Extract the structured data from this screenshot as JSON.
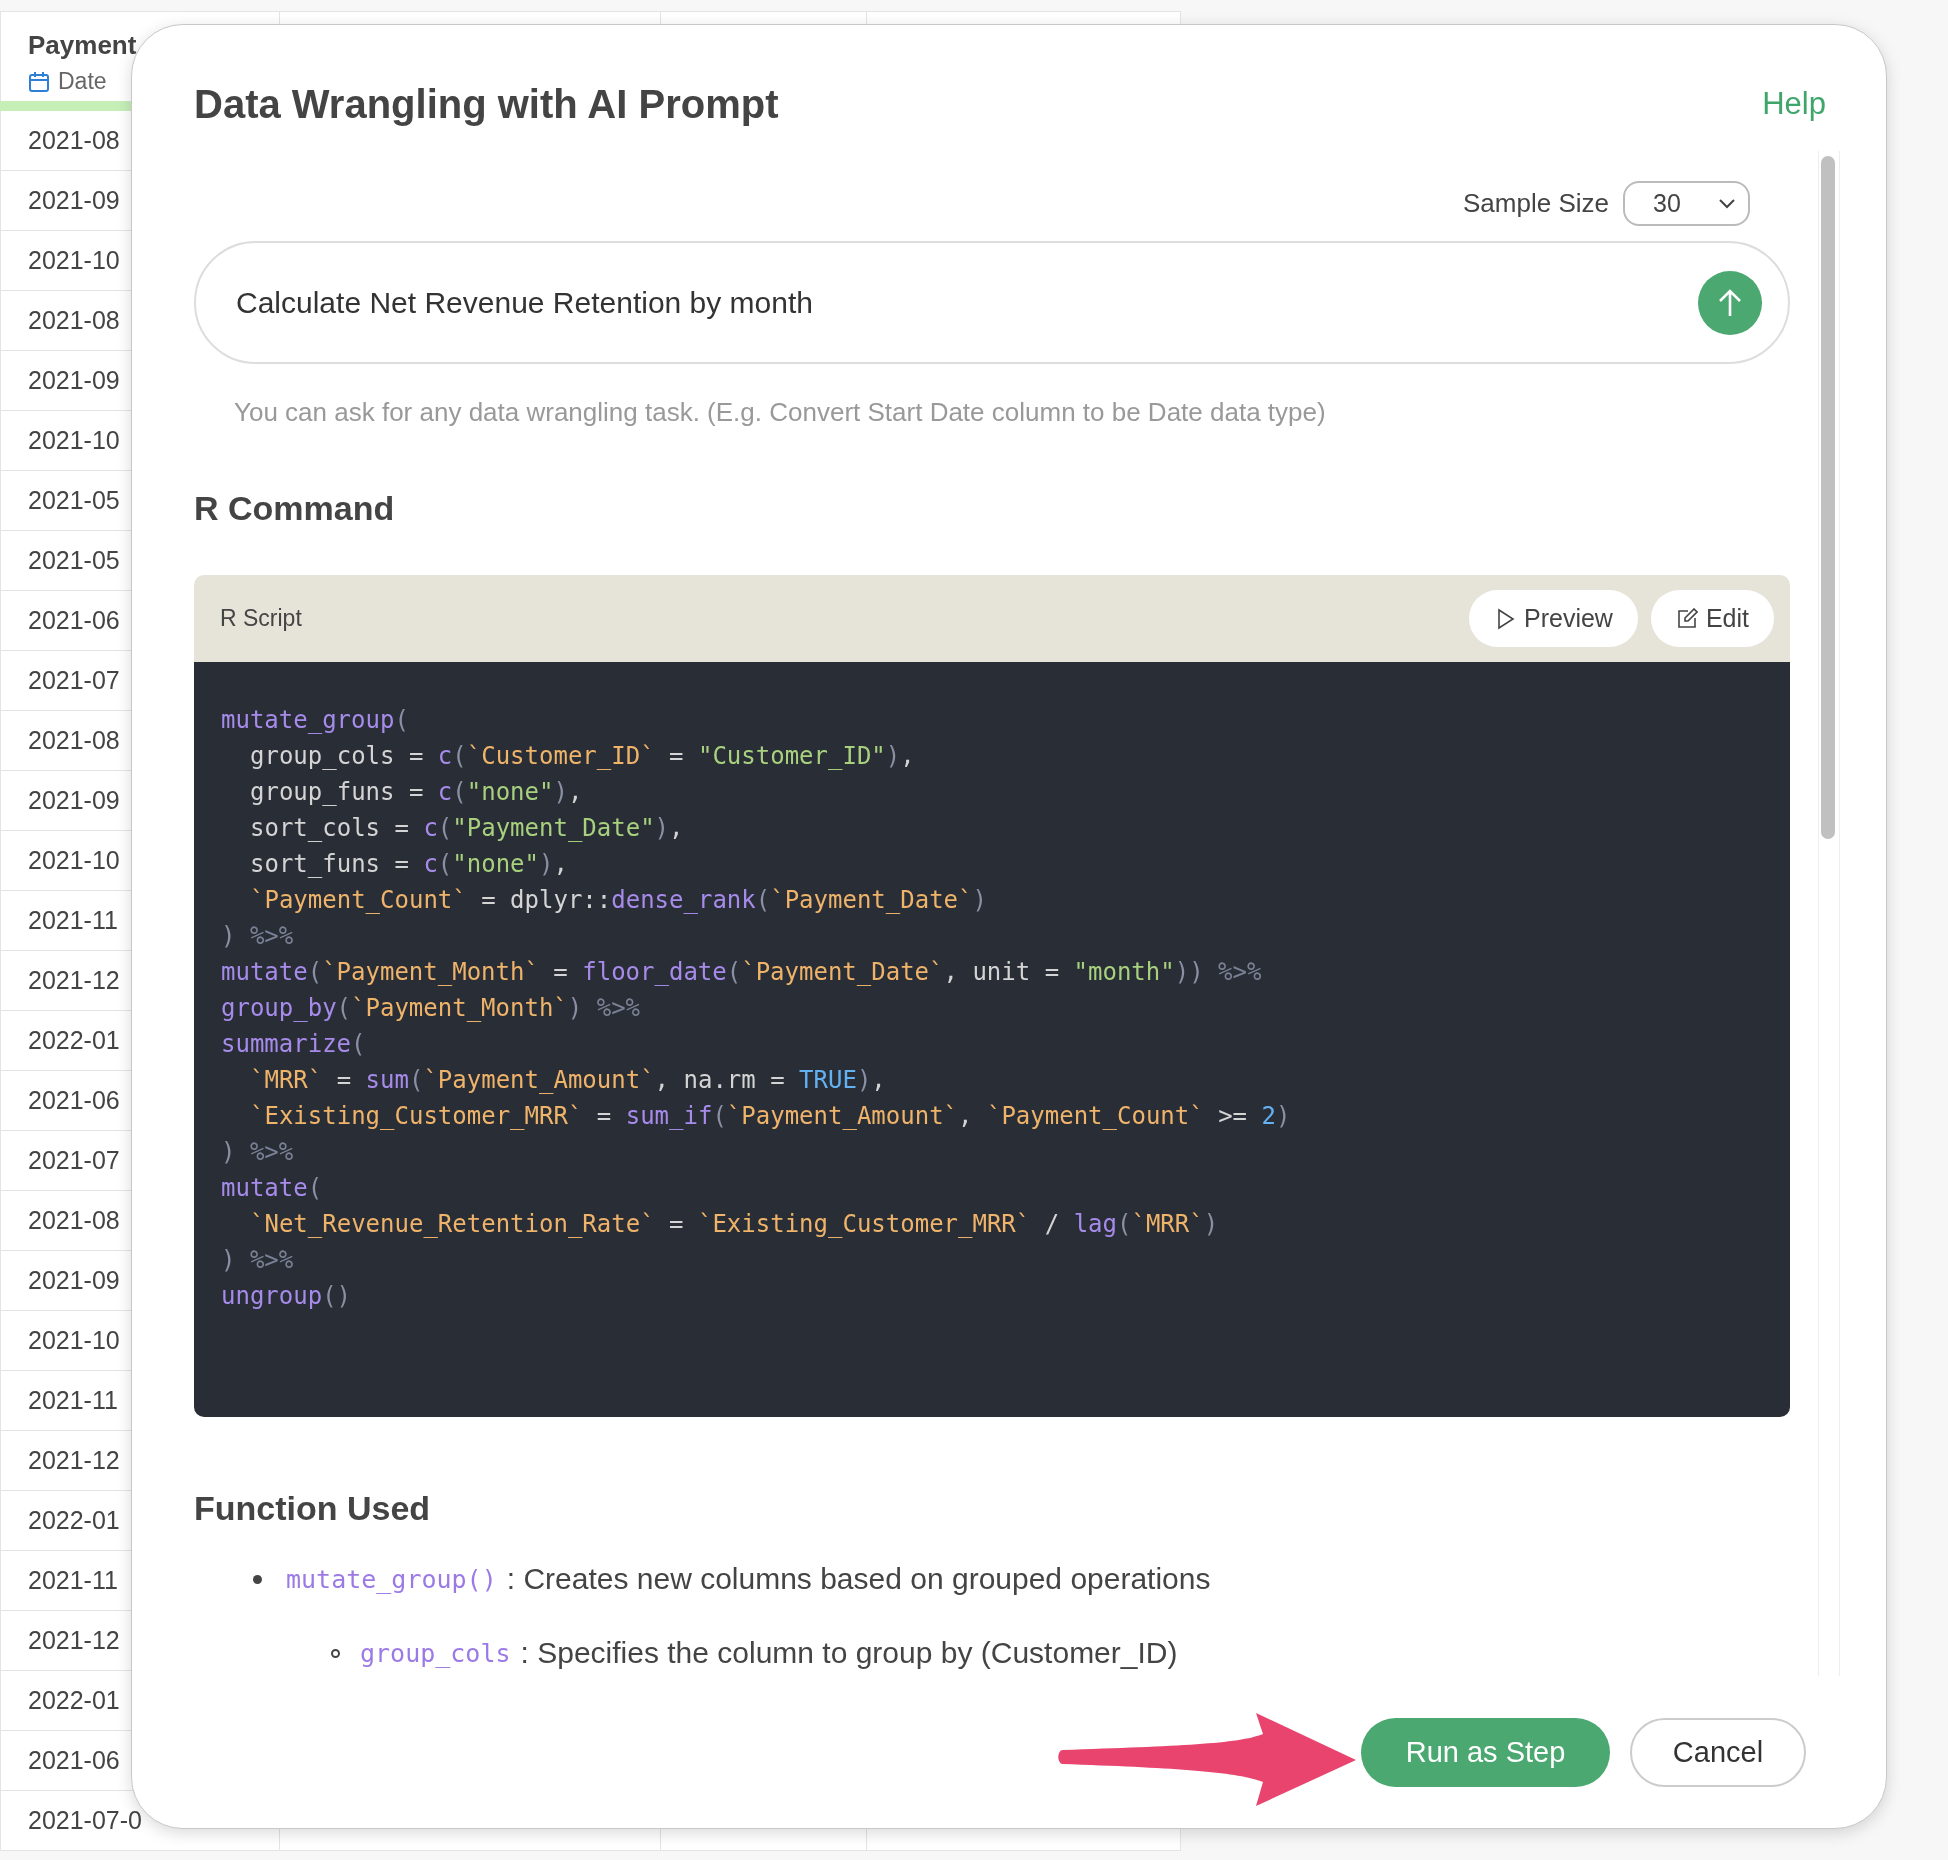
{
  "background_table": {
    "header": {
      "title": "Payment",
      "type": "Date"
    },
    "rows": [
      "2021-08",
      "2021-09",
      "2021-10",
      "2021-08",
      "2021-09",
      "2021-10",
      "2021-05",
      "2021-05",
      "2021-06",
      "2021-07",
      "2021-08",
      "2021-09",
      "2021-10",
      "2021-11",
      "2021-12",
      "2022-01",
      "2021-06",
      "2021-07",
      "2021-08",
      "2021-09",
      "2021-10",
      "2021-11",
      "2021-12",
      "2022-01",
      "2021-11",
      "2021-12",
      "2022-01",
      "2021-06",
      "2021-07-0"
    ]
  },
  "dialog": {
    "title": "Data Wrangling with AI Prompt",
    "help": "Help",
    "sample_size": {
      "label": "Sample Size",
      "value": "30"
    },
    "prompt": {
      "value": "Calculate Net Revenue Retention by month"
    },
    "hint": "You can ask for any data wrangling task. (E.g. Convert Start Date column to be Date data type)",
    "command_title": "R Command",
    "script": {
      "label": "R Script",
      "buttons": [
        "Preview",
        "Edit"
      ],
      "lines": [
        {
          "tokens": [
            {
              "kind": "fn",
              "t": "mutate_group"
            },
            {
              "kind": "punc",
              "t": "("
            }
          ],
          "children": [
            {
              "tokens": [
                {
                  "kind": "plain",
                  "t": "group_cols = "
                },
                {
                  "kind": "fn",
                  "t": "c"
                },
                {
                  "kind": "punc",
                  "t": "("
                },
                {
                  "kind": "col",
                  "t": "`Customer_ID`"
                },
                {
                  "kind": "plain",
                  "t": " = "
                },
                {
                  "kind": "str",
                  "t": "\"Customer_ID\""
                },
                {
                  "kind": "punc",
                  "t": ")"
                },
                {
                  "kind": "plain",
                  "t": ","
                }
              ]
            },
            {
              "tokens": [
                {
                  "kind": "plain",
                  "t": "group_funs = "
                },
                {
                  "kind": "fn",
                  "t": "c"
                },
                {
                  "kind": "punc",
                  "t": "("
                },
                {
                  "kind": "str",
                  "t": "\"none\""
                },
                {
                  "kind": "punc",
                  "t": ")"
                },
                {
                  "kind": "plain",
                  "t": ","
                }
              ]
            },
            {
              "tokens": [
                {
                  "kind": "plain",
                  "t": "sort_cols = "
                },
                {
                  "kind": "fn",
                  "t": "c"
                },
                {
                  "kind": "punc",
                  "t": "("
                },
                {
                  "kind": "str",
                  "t": "\"Payment_Date\""
                },
                {
                  "kind": "punc",
                  "t": ")"
                },
                {
                  "kind": "plain",
                  "t": ","
                }
              ]
            },
            {
              "tokens": [
                {
                  "kind": "plain",
                  "t": "sort_funs = "
                },
                {
                  "kind": "fn",
                  "t": "c"
                },
                {
                  "kind": "punc",
                  "t": "("
                },
                {
                  "kind": "str",
                  "t": "\"none\""
                },
                {
                  "kind": "punc",
                  "t": ")"
                },
                {
                  "kind": "plain",
                  "t": ","
                }
              ]
            },
            {
              "tokens": [
                {
                  "kind": "col",
                  "t": "`Payment_Count`"
                },
                {
                  "kind": "plain",
                  "t": " = dplyr::"
                },
                {
                  "kind": "fn",
                  "t": "dense_rank"
                },
                {
                  "kind": "punc",
                  "t": "("
                },
                {
                  "kind": "col",
                  "t": "`Payment_Date`"
                },
                {
                  "kind": "punc",
                  "t": ")"
                }
              ]
            }
          ]
        },
        {
          "tokens": [
            {
              "kind": "punc",
              "t": ")"
            },
            {
              "kind": "pipe",
              "t": " %>%"
            }
          ]
        },
        {
          "tokens": [
            {
              "kind": "fn",
              "t": "mutate"
            },
            {
              "kind": "punc",
              "t": "("
            },
            {
              "kind": "col",
              "t": "`Payment_Month`"
            },
            {
              "kind": "plain",
              "t": " = "
            },
            {
              "kind": "fn",
              "t": "floor_date"
            },
            {
              "kind": "punc",
              "t": "("
            },
            {
              "kind": "col",
              "t": "`Payment_Date`"
            },
            {
              "kind": "plain",
              "t": ", unit = "
            },
            {
              "kind": "str",
              "t": "\"month\""
            },
            {
              "kind": "punc",
              "t": "))"
            },
            {
              "kind": "pipe",
              "t": " %>%"
            }
          ]
        },
        {
          "tokens": [
            {
              "kind": "fn",
              "t": "group_by"
            },
            {
              "kind": "punc",
              "t": "("
            },
            {
              "kind": "col",
              "t": "`Payment_Month`"
            },
            {
              "kind": "punc",
              "t": ")"
            },
            {
              "kind": "pipe",
              "t": " %>%"
            }
          ]
        },
        {
          "tokens": [
            {
              "kind": "fn",
              "t": "summarize"
            },
            {
              "kind": "punc",
              "t": "("
            }
          ],
          "children": [
            {
              "tokens": [
                {
                  "kind": "col",
                  "t": "`MRR`"
                },
                {
                  "kind": "plain",
                  "t": " = "
                },
                {
                  "kind": "fn",
                  "t": "sum"
                },
                {
                  "kind": "punc",
                  "t": "("
                },
                {
                  "kind": "col",
                  "t": "`Payment_Amount`"
                },
                {
                  "kind": "plain",
                  "t": ", na.rm = "
                },
                {
                  "kind": "lit",
                  "t": "TRUE"
                },
                {
                  "kind": "punc",
                  "t": ")"
                },
                {
                  "kind": "plain",
                  "t": ","
                }
              ]
            },
            {
              "tokens": [
                {
                  "kind": "col",
                  "t": "`Existing_Customer_MRR`"
                },
                {
                  "kind": "plain",
                  "t": " = "
                },
                {
                  "kind": "fn",
                  "t": "sum_if"
                },
                {
                  "kind": "punc",
                  "t": "("
                },
                {
                  "kind": "col",
                  "t": "`Payment_Amount`"
                },
                {
                  "kind": "plain",
                  "t": ", "
                },
                {
                  "kind": "col",
                  "t": "`Payment_Count`"
                },
                {
                  "kind": "plain",
                  "t": " >= "
                },
                {
                  "kind": "lit",
                  "t": "2"
                },
                {
                  "kind": "punc",
                  "t": ")"
                }
              ]
            }
          ]
        },
        {
          "tokens": [
            {
              "kind": "punc",
              "t": ")"
            },
            {
              "kind": "pipe",
              "t": " %>%"
            }
          ]
        },
        {
          "tokens": [
            {
              "kind": "fn",
              "t": "mutate"
            },
            {
              "kind": "punc",
              "t": "("
            }
          ],
          "children": [
            {
              "tokens": [
                {
                  "kind": "col",
                  "t": "`Net_Revenue_Retention_Rate`"
                },
                {
                  "kind": "plain",
                  "t": " = "
                },
                {
                  "kind": "col",
                  "t": "`Existing_Customer_MRR`"
                },
                {
                  "kind": "plain",
                  "t": " / "
                },
                {
                  "kind": "fn",
                  "t": "lag"
                },
                {
                  "kind": "punc",
                  "t": "("
                },
                {
                  "kind": "col",
                  "t": "`MRR`"
                },
                {
                  "kind": "punc",
                  "t": ")"
                }
              ]
            }
          ]
        },
        {
          "tokens": [
            {
              "kind": "punc",
              "t": ")"
            },
            {
              "kind": "pipe",
              "t": " %>%"
            }
          ]
        },
        {
          "tokens": [
            {
              "kind": "fn",
              "t": "ungroup"
            },
            {
              "kind": "punc",
              "t": "()"
            }
          ]
        }
      ]
    },
    "functions_title": "Function Used",
    "functions": [
      {
        "name": "mutate_group()",
        "desc": ": Creates new columns based on grouped operations",
        "children": [
          {
            "name": "group_cols",
            "desc": ": Specifies the column to group by (Customer_ID)"
          }
        ]
      }
    ],
    "buttons": [
      {
        "label": "Run as Step",
        "kind": "primary"
      },
      {
        "label": "Cancel",
        "kind": "secondary"
      }
    ]
  }
}
